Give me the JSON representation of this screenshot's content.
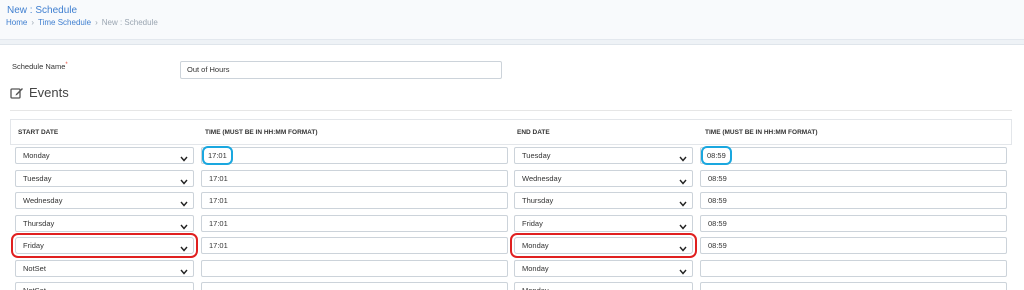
{
  "header": {
    "title": "New : Schedule",
    "breadcrumb": [
      "Home",
      "Time Schedule",
      "New : Schedule"
    ]
  },
  "form": {
    "schedule_name_label": "Schedule Name",
    "required_mark": "*",
    "schedule_name_value": "Out of Hours"
  },
  "events": {
    "title": "Events",
    "columns": [
      "START DATE",
      "TIME (MUST BE IN HH:MM FORMAT)",
      "END DATE",
      "TIME (MUST BE IN HH:MM FORMAT)"
    ],
    "rows": [
      {
        "start_day": "Monday",
        "start_time": "17:01",
        "end_day": "Tuesday",
        "end_time": "08:59"
      },
      {
        "start_day": "Tuesday",
        "start_time": "17:01",
        "end_day": "Wednesday",
        "end_time": "08:59"
      },
      {
        "start_day": "Wednesday",
        "start_time": "17:01",
        "end_day": "Thursday",
        "end_time": "08:59"
      },
      {
        "start_day": "Thursday",
        "start_time": "17:01",
        "end_day": "Friday",
        "end_time": "08:59"
      },
      {
        "start_day": "Friday",
        "start_time": "17:01",
        "end_day": "Monday",
        "end_time": "08:59"
      },
      {
        "start_day": "NotSet",
        "start_time": "",
        "end_day": "Monday",
        "end_time": ""
      },
      {
        "start_day": "NotSet",
        "start_time": "",
        "end_day": "Monday",
        "end_time": ""
      }
    ]
  },
  "colors": {
    "link": "#3f7fd0",
    "highlight_red": "#e02020",
    "highlight_blue": "#1aa7df"
  }
}
